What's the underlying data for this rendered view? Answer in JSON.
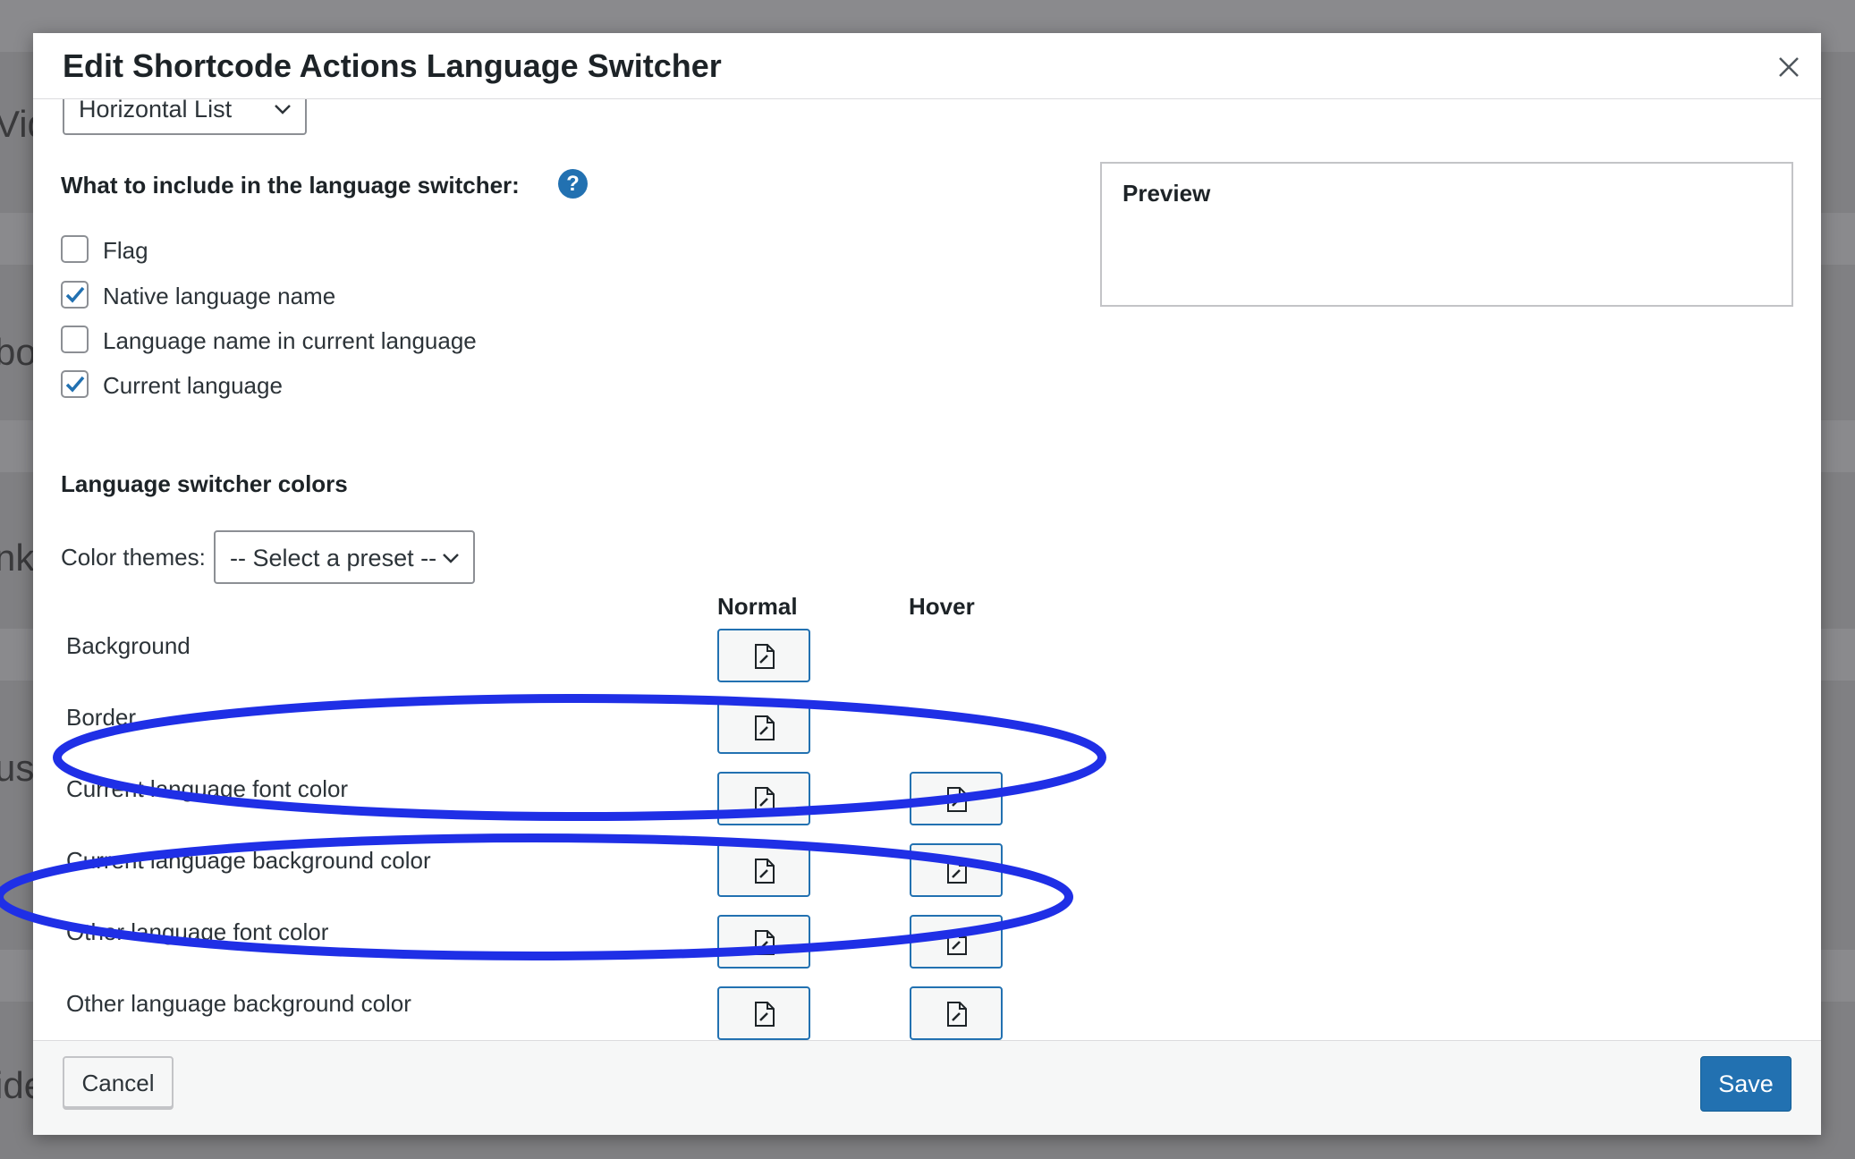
{
  "background_fragments": [
    "Vid",
    "bo",
    "nk",
    "us",
    "ide"
  ],
  "modal": {
    "title": "Edit Shortcode Actions Language Switcher",
    "layout_select_value": "Horizontal List",
    "include_label": "What to include in the language switcher:",
    "help_glyph": "?",
    "checkboxes": [
      {
        "label": "Flag",
        "checked": false
      },
      {
        "label": "Native language name",
        "checked": true
      },
      {
        "label": "Language name in current language",
        "checked": false
      },
      {
        "label": "Current language",
        "checked": true
      }
    ],
    "colors_heading": "Language switcher colors",
    "color_themes_label": "Color themes:",
    "color_themes_value": "-- Select a preset --",
    "col_normal": "Normal",
    "col_hover": "Hover",
    "color_rows": [
      {
        "label": "Background",
        "normal": true,
        "hover": false
      },
      {
        "label": "Border",
        "normal": true,
        "hover": false
      },
      {
        "label": "Current language font color",
        "normal": true,
        "hover": true
      },
      {
        "label": "Current language background color",
        "normal": true,
        "hover": true
      },
      {
        "label": "Other language font color",
        "normal": true,
        "hover": true
      },
      {
        "label": "Other language background color",
        "normal": true,
        "hover": true
      }
    ],
    "preview_title": "Preview",
    "cancel_label": "Cancel",
    "save_label": "Save"
  },
  "colors": {
    "accent": "#2271b1",
    "annotation": "#1f2fe6",
    "overlay": "#808083"
  },
  "icons": {
    "close": "close-icon",
    "chevron": "chevron-down-icon",
    "check": "check-icon",
    "color_edit": "edit-document-icon",
    "help": "question-mark-icon"
  }
}
